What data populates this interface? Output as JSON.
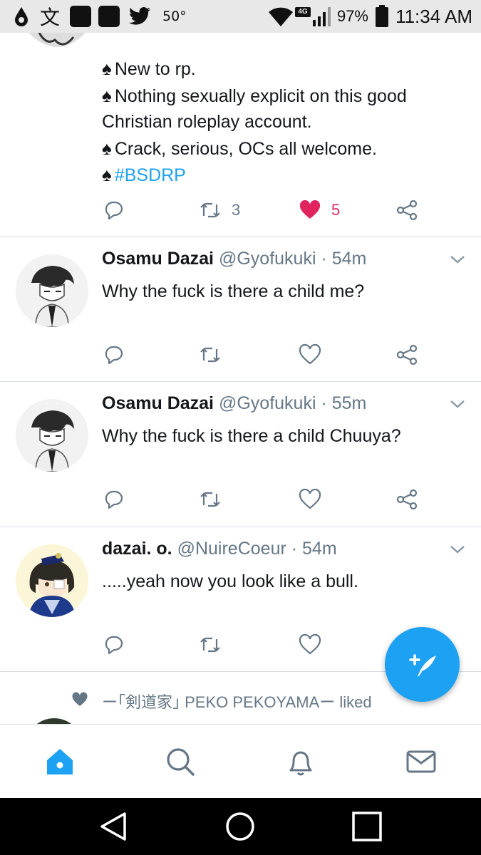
{
  "status_bar": {
    "temperature": "50°",
    "network": "4G",
    "battery": "97%",
    "time": "11:34 AM"
  },
  "tweets": [
    {
      "lines": [
        "New to rp.",
        "Nothing sexually explicit on this good",
        "Christian roleplay account.",
        "Crack, serious, OCs all welcome.",
        "#BSDRP"
      ],
      "retweets": "3",
      "likes": "5"
    },
    {
      "name": "Osamu Dazai",
      "handle": "@Gyofukuki · 54m",
      "text": "Why the fuck is there a child me?"
    },
    {
      "name": "Osamu Dazai",
      "handle": "@Gyofukuki · 55m",
      "text": "Why the fuck is there a child Chuuya?"
    },
    {
      "name": "dazai. o.",
      "handle": "@NuireCoeur · 54m",
      "text": ".....yeah now you look like a bull."
    }
  ],
  "liked_notice": "ー｢剣道家｣ PEKO PEKOYAMAー liked",
  "colors": {
    "accent": "#1da1f2",
    "like": "#e0245e",
    "muted": "#657786"
  },
  "icons": {
    "reply": "reply-icon",
    "retweet": "retweet-icon",
    "like": "heart-icon",
    "share": "share-icon",
    "compose": "compose-tweet-icon",
    "home": "home-icon",
    "search": "search-icon",
    "notifications": "bell-icon",
    "messages": "envelope-icon"
  }
}
